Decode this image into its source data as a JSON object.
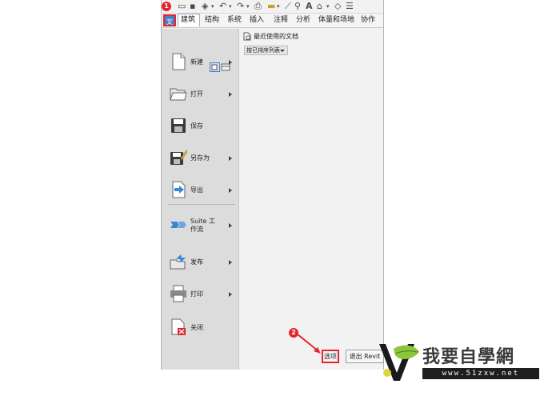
{
  "ribbon": {
    "file_tab": "文件",
    "tabs": [
      "建筑",
      "结构",
      "系统",
      "插入",
      "注释",
      "分析",
      "体量和场地",
      "协作"
    ]
  },
  "file_menu": {
    "items": [
      {
        "label": "新建",
        "icon": "new-doc-icon",
        "submenu": true
      },
      {
        "label": "打开",
        "icon": "open-folder-icon",
        "submenu": true
      },
      {
        "label": "保存",
        "icon": "save-icon",
        "submenu": false
      },
      {
        "label": "另存为",
        "icon": "save-as-icon",
        "submenu": true
      },
      {
        "label": "导出",
        "icon": "export-icon",
        "submenu": true
      },
      {
        "label": "Suite 工作流",
        "icon": "suite-workflow-icon",
        "submenu": true
      },
      {
        "label": "发布",
        "icon": "publish-icon",
        "submenu": true
      },
      {
        "label": "打印",
        "icon": "print-icon",
        "submenu": true
      },
      {
        "label": "关闭",
        "icon": "close-doc-icon",
        "submenu": false
      }
    ]
  },
  "recent": {
    "title": "最近使用的文档",
    "sort_value": "按已排序列表"
  },
  "footer": {
    "options_label": "选项",
    "exit_label": "退出 Revit"
  },
  "annotations": {
    "step1": "1",
    "step2": "2"
  },
  "watermark": {
    "text": "我要自學網",
    "url": "www.51zxw.net"
  },
  "colors": {
    "annotation_red": "#e3242b",
    "file_tab_blue": "#4a7ec4",
    "menu_bg": "#dcdcdc"
  }
}
